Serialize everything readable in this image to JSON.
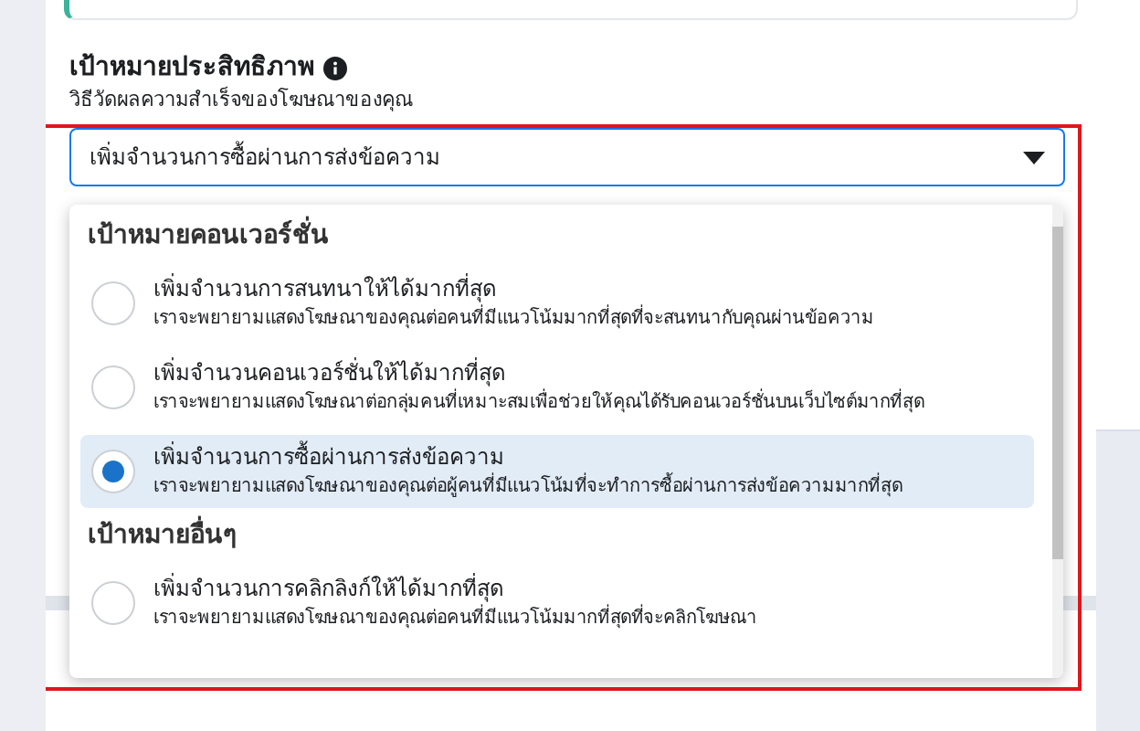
{
  "section": {
    "title": "เป้าหมายประสิทธิภาพ",
    "subtitle": "วิธีวัดผลความสำเร็จของโฆษณาของคุณ"
  },
  "select": {
    "value": "เพิ่มจำนวนการซื้อผ่านการส่งข้อความ",
    "expanded": true
  },
  "groups": [
    {
      "title": "เป้าหมายคอนเวอร์ชั่น",
      "options": [
        {
          "label": "เพิ่มจำนวนการสนทนาให้ได้มากที่สุด",
          "description": "เราจะพยายามแสดงโฆษณาของคุณต่อคนที่มีแนวโน้มมากที่สุดที่จะสนทนากับคุณผ่านข้อความ",
          "selected": false
        },
        {
          "label": "เพิ่มจำนวนคอนเวอร์ชั่นให้ได้มากที่สุด",
          "description": "เราจะพยายามแสดงโฆษณาต่อกลุ่มคนที่เหมาะสมเพื่อช่วยให้คุณได้รับคอนเวอร์ชั่นบนเว็บไซต์มากที่สุด",
          "selected": false
        },
        {
          "label": "เพิ่มจำนวนการซื้อผ่านการส่งข้อความ",
          "description": "เราจะพยายามแสดงโฆษณาของคุณต่อผู้คนที่มีแนวโน้มที่จะทำการซื้อผ่านการส่งข้อความมากที่สุด",
          "selected": true
        }
      ]
    },
    {
      "title": "เป้าหมายอื่นๆ",
      "options": [
        {
          "label": "เพิ่มจำนวนการคลิกลิงก์ให้ได้มากที่สุด",
          "description": "เราจะพยายามแสดงโฆษณาของคุณต่อคนที่มีแนวโน้มมากที่สุดที่จะคลิกโฆษณา",
          "selected": false
        }
      ]
    }
  ]
}
